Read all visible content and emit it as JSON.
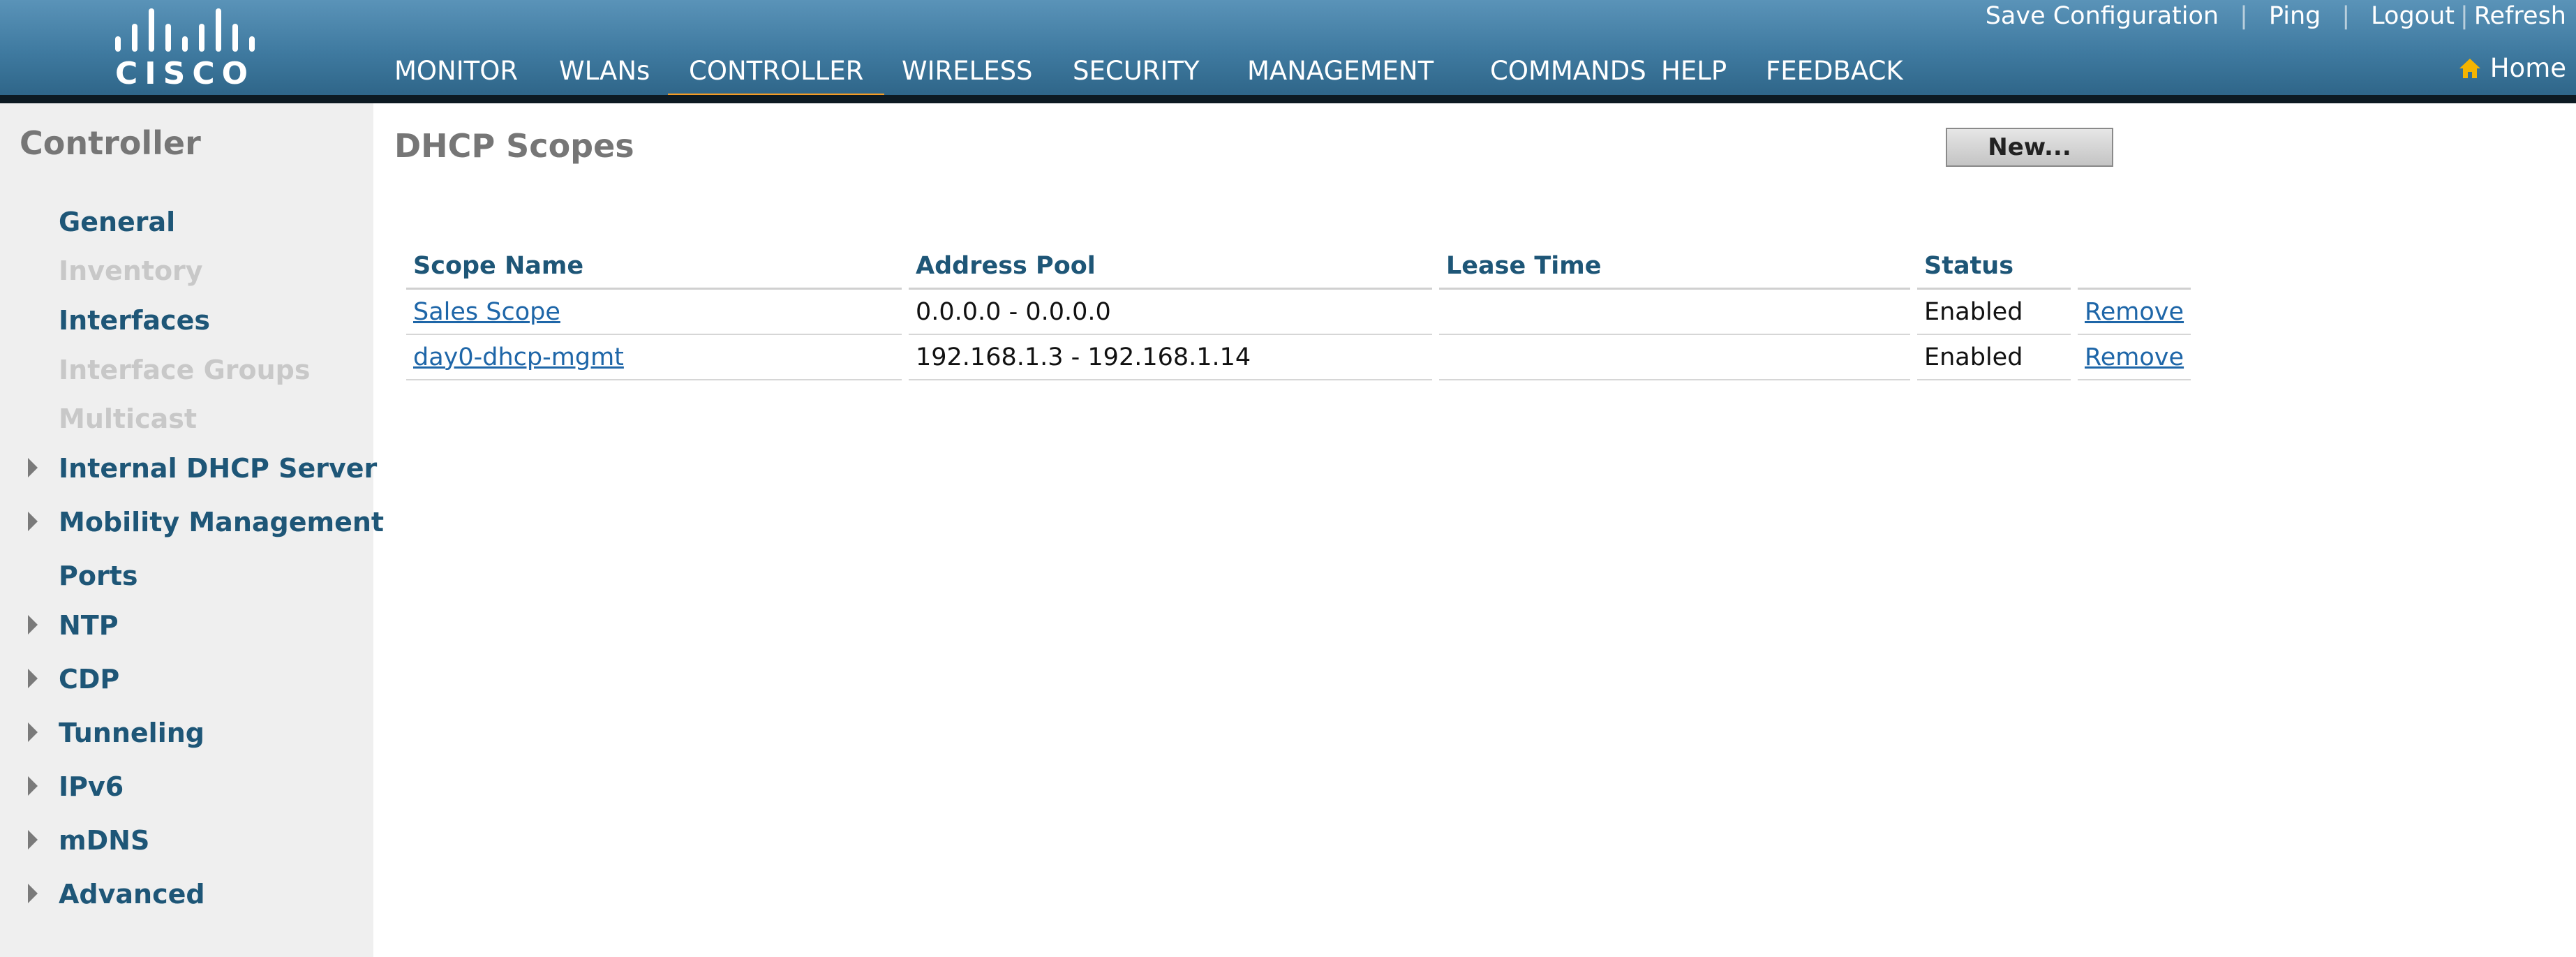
{
  "header": {
    "logo_text": "CISCO",
    "top_links": [
      {
        "label": "Save Configuration"
      },
      {
        "label": "Ping"
      },
      {
        "label": "Logout"
      },
      {
        "label": "Refresh"
      }
    ],
    "home_label": "Home",
    "accent_color": "#f59c24",
    "nav": [
      {
        "label": "MONITOR"
      },
      {
        "label": "WLANs"
      },
      {
        "label": "CONTROLLER"
      },
      {
        "label": "WIRELESS"
      },
      {
        "label": "SECURITY"
      },
      {
        "label": "MANAGEMENT"
      },
      {
        "label": "COMMANDS"
      },
      {
        "label": "HELP"
      },
      {
        "label": "FEEDBACK"
      }
    ],
    "active_nav": "CONTROLLER"
  },
  "sidebar": {
    "title": "Controller",
    "items": [
      {
        "label": "General",
        "expandable": false,
        "enabled": true
      },
      {
        "label": "Inventory",
        "expandable": false,
        "enabled": false
      },
      {
        "label": "Interfaces",
        "expandable": false,
        "enabled": true
      },
      {
        "label": "Interface Groups",
        "expandable": false,
        "enabled": false
      },
      {
        "label": "Multicast",
        "expandable": false,
        "enabled": false
      },
      {
        "label": "Internal DHCP Server",
        "expandable": true,
        "enabled": true
      },
      {
        "label": "Mobility Management",
        "expandable": true,
        "enabled": true
      },
      {
        "label": "Ports",
        "expandable": false,
        "enabled": true
      },
      {
        "label": "NTP",
        "expandable": true,
        "enabled": true
      },
      {
        "label": "CDP",
        "expandable": true,
        "enabled": true
      },
      {
        "label": "Tunneling",
        "expandable": true,
        "enabled": true
      },
      {
        "label": "IPv6",
        "expandable": true,
        "enabled": true
      },
      {
        "label": "mDNS",
        "expandable": true,
        "enabled": true
      },
      {
        "label": "Advanced",
        "expandable": true,
        "enabled": true
      }
    ]
  },
  "main": {
    "title": "DHCP Scopes",
    "new_button": "New...",
    "table": {
      "columns": [
        "Scope Name",
        "Address Pool",
        "Lease Time",
        "Status"
      ],
      "rows": [
        {
          "name": "Sales Scope",
          "pool": "0.0.0.0 - 0.0.0.0",
          "lease": "",
          "status": "Enabled",
          "action": "Remove"
        },
        {
          "name": "day0-dhcp-mgmt",
          "pool": "192.168.1.3 - 192.168.1.14",
          "lease": "",
          "status": "Enabled",
          "action": "Remove"
        }
      ]
    }
  }
}
